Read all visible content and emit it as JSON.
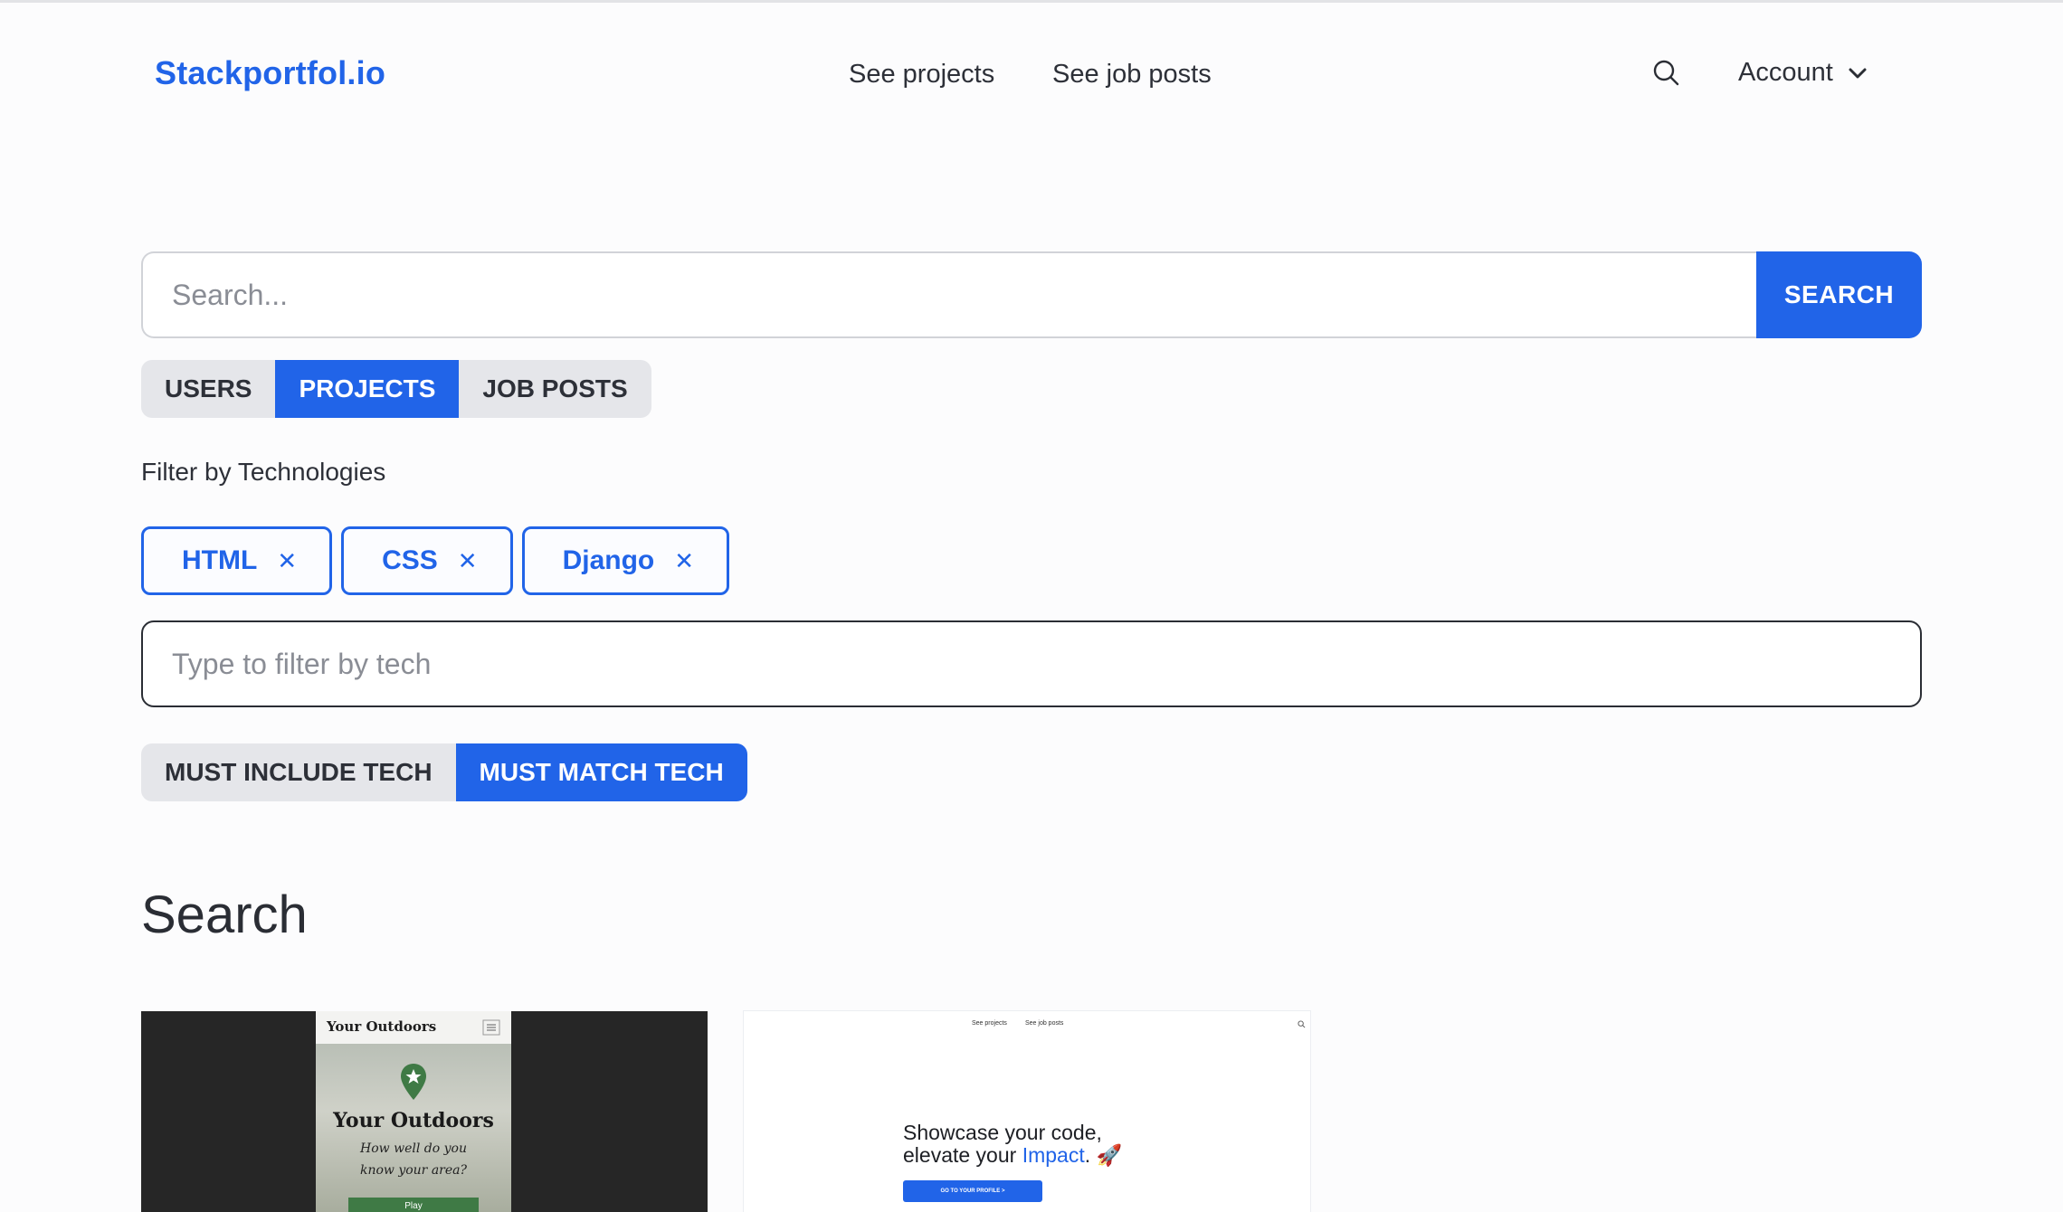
{
  "header": {
    "logo": "Stackportfol.io",
    "nav": [
      "See projects",
      "See job posts"
    ],
    "search_icon": "search-icon",
    "account_label": "Account",
    "account_icon": "chevron-down-icon"
  },
  "search": {
    "placeholder": "Search...",
    "value": "",
    "submit_label": "SEARCH"
  },
  "type_tabs": {
    "options": [
      "USERS",
      "PROJECTS",
      "JOB POSTS"
    ],
    "selected": "PROJECTS"
  },
  "tech_filter": {
    "label": "Filter by Technologies",
    "chips": [
      {
        "label": "HTML",
        "remove_icon": "close-icon"
      },
      {
        "label": "CSS",
        "remove_icon": "close-icon"
      },
      {
        "label": "Django",
        "remove_icon": "close-icon"
      }
    ],
    "input_placeholder": "Type to filter by tech",
    "match_mode": {
      "options": [
        "MUST INCLUDE TECH",
        "MUST MATCH TECH"
      ],
      "selected": "MUST MATCH TECH"
    }
  },
  "results": {
    "title": "Search",
    "cards": [
      {
        "preview_logo": "Your Outdoors",
        "preview_title": "Your Outdoors",
        "preview_subtitle_1": "How well do you",
        "preview_subtitle_2": "know your area?",
        "preview_button": "Play"
      },
      {
        "preview_nav_1": "See projects",
        "preview_nav_2": "See job posts",
        "preview_headline_1": "Showcase your code,",
        "preview_headline_2a": "elevate your ",
        "preview_headline_2b": "Impact",
        "preview_headline_2c": ". 🚀",
        "preview_button": "GO TO YOUR PROFILE >"
      }
    ]
  },
  "colors": {
    "accent": "#2164e8",
    "background": "#fcfcfd",
    "tab_inactive_bg": "#e5e6ea"
  }
}
